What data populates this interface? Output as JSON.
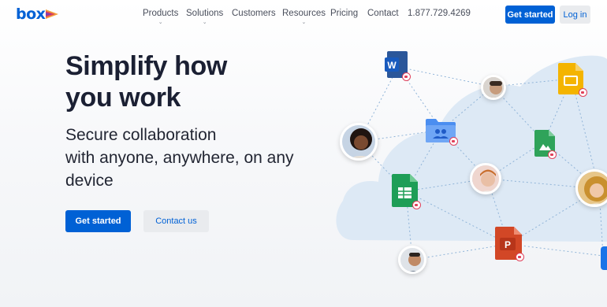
{
  "brand": {
    "logo_text": "box",
    "colors": {
      "primary": "#0061d5",
      "accent_red": "#e0405a",
      "cloud": "#dde9f5"
    }
  },
  "nav": {
    "items": [
      {
        "label": "Products",
        "has_dropdown": true
      },
      {
        "label": "Solutions",
        "has_dropdown": true
      },
      {
        "label": "Customers",
        "has_dropdown": false
      },
      {
        "label": "Resources",
        "has_dropdown": true
      },
      {
        "label": "Pricing",
        "has_dropdown": false
      },
      {
        "label": "Contact",
        "has_dropdown": false
      }
    ],
    "phone": "1.877.729.4269",
    "get_started": "Get started",
    "login": "Log in"
  },
  "hero": {
    "title_line1": "Simplify how",
    "title_line2": "you work",
    "subtitle_line1": "Secure collaboration",
    "subtitle_line2": "with anyone, anywhere, on any",
    "subtitle_line3": "device",
    "cta_primary": "Get started",
    "cta_secondary": "Contact us"
  },
  "illustration": {
    "file_icons": [
      {
        "name": "word-doc-icon",
        "letter": "W"
      },
      {
        "name": "google-slides-icon"
      },
      {
        "name": "shared-folder-icon"
      },
      {
        "name": "image-file-icon"
      },
      {
        "name": "google-sheets-icon"
      },
      {
        "name": "powerpoint-icon",
        "letter": "P"
      }
    ],
    "avatars": [
      "avatar-man-top",
      "avatar-woman-left",
      "avatar-man-center",
      "avatar-woman-right",
      "avatar-man-bottom"
    ]
  }
}
